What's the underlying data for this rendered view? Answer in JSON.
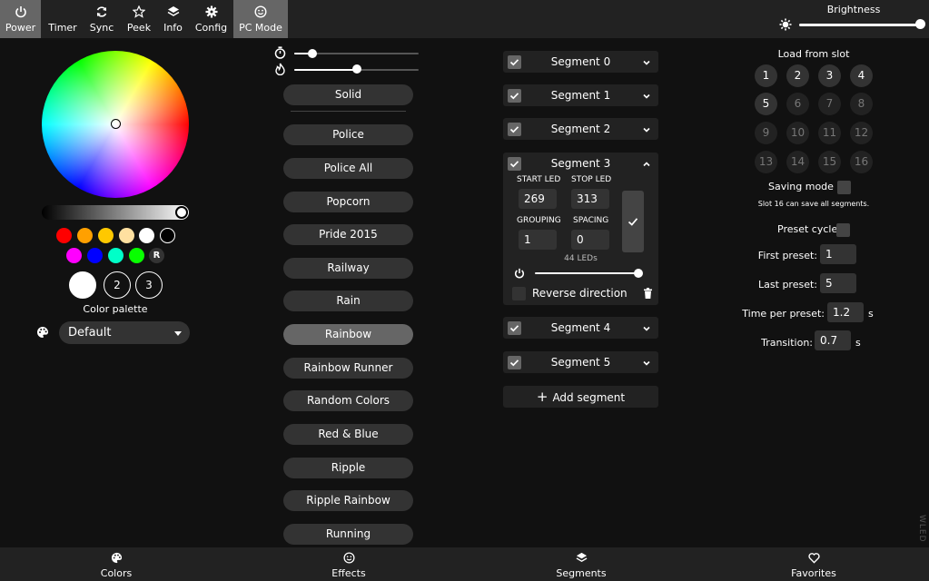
{
  "nav": {
    "items": [
      {
        "label": "Power",
        "icon": "power-icon"
      },
      {
        "label": "Timer",
        "icon": "moon-icon"
      },
      {
        "label": "Sync",
        "icon": "sync-icon"
      },
      {
        "label": "Peek",
        "icon": "star-icon"
      },
      {
        "label": "Info",
        "icon": "layers-icon"
      },
      {
        "label": "Config",
        "icon": "gear-icon"
      },
      {
        "label": "PC Mode",
        "icon": "smiley-icon"
      }
    ],
    "brightness_label": "Brightness",
    "brightness_level": 0.97
  },
  "colors": {
    "swatches_row1": [
      "#ff0000",
      "#ffa000",
      "#ffc800",
      "#ffe0a0",
      "#ffffff",
      "#000000"
    ],
    "swatches_row2": [
      "#ff00ff",
      "#0000ff",
      "#00ffc8",
      "#08ff00"
    ],
    "random_label": "R",
    "slots": [
      "",
      "2",
      "3"
    ],
    "palette_label": "Color palette",
    "palette_value": "Default"
  },
  "effects": {
    "speed_level": 0.12,
    "intensity_level": 0.5,
    "list": [
      "Solid",
      "Police",
      "Police All",
      "Popcorn",
      "Pride 2015",
      "Railway",
      "Rain",
      "Rainbow",
      "Rainbow Runner",
      "Random Colors",
      "Red & Blue",
      "Ripple",
      "Ripple Rainbow",
      "Running"
    ],
    "selected": "Rainbow"
  },
  "segments": {
    "rows": [
      {
        "title": "Segment 0"
      },
      {
        "title": "Segment 1"
      },
      {
        "title": "Segment 2"
      },
      {
        "title": "Segment 4"
      },
      {
        "title": "Segment 5"
      }
    ],
    "expanded": {
      "title": "Segment 3",
      "start_label": "START LED",
      "stop_label": "STOP LED",
      "start": "269",
      "stop": "313",
      "grouping_label": "GROUPING",
      "spacing_label": "SPACING",
      "grouping": "1",
      "spacing": "0",
      "led_count": "44 LEDs",
      "segment_brightness": 1.0,
      "reverse_label": "Reverse direction"
    },
    "add_label": "Add segment"
  },
  "presets": {
    "load_label": "Load from slot",
    "slots": [
      "1",
      "2",
      "3",
      "4",
      "5",
      "6",
      "7",
      "8",
      "9",
      "10",
      "11",
      "12",
      "13",
      "14",
      "15",
      "16"
    ],
    "used_slots": [
      "1",
      "2",
      "3",
      "4",
      "5"
    ],
    "saving_mode_label": "Saving mode",
    "saving_note": "Slot 16 can save all segments.",
    "preset_cycle_label": "Preset cycle",
    "first_label": "First preset:",
    "first_value": "1",
    "last_label": "Last preset:",
    "last_value": "5",
    "time_label": "Time per preset:",
    "time_value": "1.2",
    "time_unit": "s",
    "transition_label": "Transition:",
    "transition_value": "0.7",
    "transition_unit": "s"
  },
  "bottom": {
    "tabs": [
      {
        "label": "Colors",
        "icon": "palette-icon"
      },
      {
        "label": "Effects",
        "icon": "smiley-icon"
      },
      {
        "label": "Segments",
        "icon": "layers-icon"
      },
      {
        "label": "Favorites",
        "icon": "heart-icon"
      }
    ]
  },
  "logo": "WLED"
}
